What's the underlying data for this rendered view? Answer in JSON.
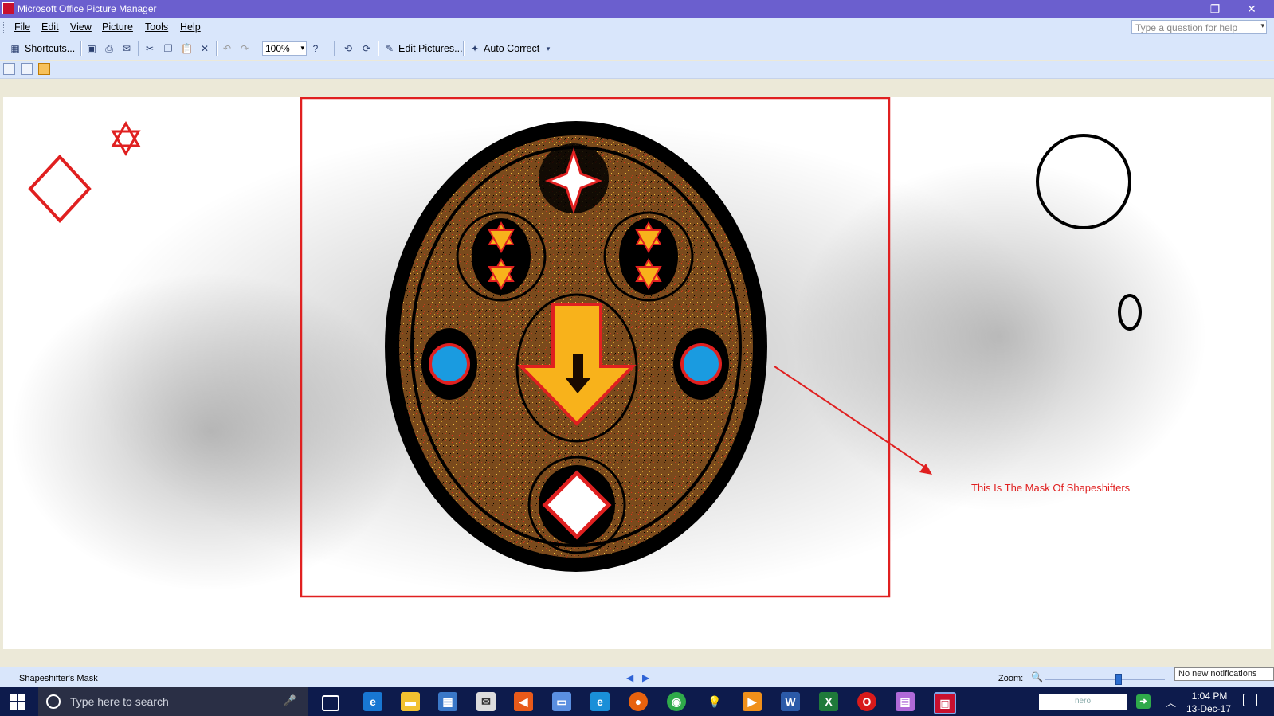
{
  "window": {
    "title": "Microsoft Office Picture Manager",
    "minimize": "—",
    "restore": "❐",
    "close": "✕"
  },
  "menu": {
    "items": [
      "File",
      "Edit",
      "View",
      "Picture",
      "Tools",
      "Help"
    ],
    "help_placeholder": "Type a question for help"
  },
  "toolbar": {
    "shortcuts_label": "Shortcuts...",
    "zoom_value": "100%",
    "edit_pictures_label": "Edit Pictures...",
    "auto_correct_label": "Auto Correct"
  },
  "picture": {
    "annotation": "This Is The Mask Of Shapeshifters"
  },
  "status": {
    "filename": "Shapeshifter's Mask",
    "zoom_label": "Zoom:",
    "zoom_level": 0.62,
    "notification": "No new notifications"
  },
  "taskbar": {
    "search_placeholder": "Type here to search",
    "nero_label": "nero",
    "time": "1:04 PM",
    "date": "13-Dec-17"
  },
  "colors": {
    "accent_red": "#e02020",
    "mask_brown": "#7a4a1c",
    "arrow_orange": "#f8b21b",
    "eye_blue": "#1a9be0"
  }
}
